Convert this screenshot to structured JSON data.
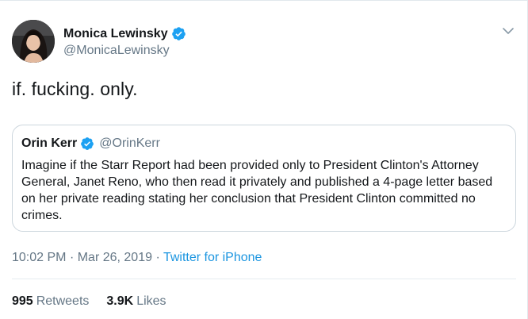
{
  "author": {
    "display_name": "Monica Lewinsky",
    "handle": "@MonicaLewinsky",
    "verified": true
  },
  "tweet": {
    "text": "if. fucking. only."
  },
  "quoted_tweet": {
    "display_name": "Orin Kerr",
    "handle": "@OrinKerr",
    "verified": true,
    "text": "Imagine if the Starr Report had been provided only to President Clinton's Attorney General, Janet Reno, who then read it privately and published a 4-page letter based on her private reading stating her conclusion that President Clinton committed no crimes."
  },
  "meta": {
    "time": "10:02 PM",
    "separator": "·",
    "date": "Mar 26, 2019",
    "source": "Twitter for iPhone"
  },
  "stats": {
    "retweets_count": "995",
    "retweets_label": "Retweets",
    "likes_count": "3.9K",
    "likes_label": "Likes"
  },
  "colors": {
    "verified": "#1da1f2",
    "link": "#1b95e0",
    "secondary_text": "#657786"
  },
  "icons": {
    "verified": "verified-badge-icon",
    "menu": "chevron-down-icon"
  }
}
